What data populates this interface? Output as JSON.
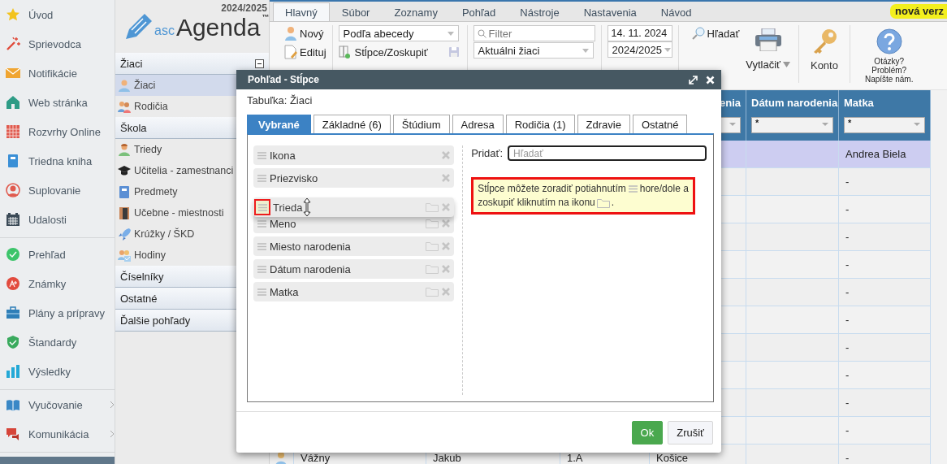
{
  "nav": {
    "groups": [
      [
        {
          "label": "Úvod",
          "expandable": false
        },
        {
          "label": "Sprievodca",
          "expandable": false
        },
        {
          "label": "Notifikácie",
          "expandable": false
        },
        {
          "label": "Web stránka",
          "expandable": false
        },
        {
          "label": "Rozvrhy Online",
          "expandable": false
        },
        {
          "label": "Triedna kniha",
          "expandable": false
        },
        {
          "label": "Suplovanie",
          "expandable": false
        },
        {
          "label": "Udalosti",
          "expandable": false
        }
      ],
      [
        {
          "label": "Prehľad",
          "expandable": false
        },
        {
          "label": "Známky",
          "expandable": false
        },
        {
          "label": "Plány a prípravy",
          "expandable": false
        },
        {
          "label": "Štandardy",
          "expandable": false
        },
        {
          "label": "Výsledky",
          "expandable": false
        }
      ],
      [
        {
          "label": "Vyučovanie",
          "expandable": true
        },
        {
          "label": "Komunikácia",
          "expandable": true
        }
      ]
    ]
  },
  "logo": {
    "year": "2024/2025",
    "prefix": "asc",
    "brand": "Agenda",
    "trademark": "™"
  },
  "sections": [
    {
      "label": "Žiaci",
      "collapsible": true,
      "items": [
        {
          "label": "Žiaci",
          "selected": true
        },
        {
          "label": "Rodičia",
          "selected": false
        }
      ]
    },
    {
      "label": "Škola",
      "items": [
        {
          "label": "Triedy",
          "selected": false
        },
        {
          "label": "Učitelia - zamestnanci",
          "selected": false
        },
        {
          "label": "Predmety",
          "selected": false
        },
        {
          "label": "Učebne - miestnosti",
          "selected": false
        },
        {
          "label": "Krúžky / ŠKD",
          "selected": false
        },
        {
          "label": "Hodiny",
          "selected": false
        }
      ]
    },
    {
      "label": "Číselníky"
    },
    {
      "label": "Ostatné"
    },
    {
      "label": "Ďalšie pohľady"
    }
  ],
  "menu_tabs": [
    {
      "label": "Hlavný",
      "selected": true
    },
    {
      "label": "Súbor",
      "selected": false
    },
    {
      "label": "Zoznamy",
      "selected": false
    },
    {
      "label": "Pohľad",
      "selected": false
    },
    {
      "label": "Nástroje",
      "selected": false
    },
    {
      "label": "Nastavenia",
      "selected": false
    },
    {
      "label": "Návod",
      "selected": false
    }
  ],
  "badge": "nová verz",
  "ribbon": {
    "new": "Nový",
    "edit": "Edituj",
    "sort": "Podľa abecedy",
    "columns": "Stĺpce/Zoskupiť",
    "filter_placeholder": "Filter",
    "scope": "Aktuálni žiaci",
    "date": "14. 11. 2024",
    "year": "2024/2025",
    "search": "Hľadať",
    "print": "Vytlačiť",
    "account": "Konto",
    "help": [
      "Otázky?",
      "Problém?",
      "Napíšte nám."
    ]
  },
  "table": {
    "columns": [
      {
        "label": "enia"
      },
      {
        "label": "Dátum narodenia",
        "filter": "*"
      },
      {
        "label": "Matka",
        "filter": "*"
      }
    ],
    "rows": [
      {
        "selected": true,
        "cells": {
          "mother": "Andrea Biela"
        }
      },
      {
        "selected": false,
        "cells": {
          "mother": "-"
        }
      },
      {
        "selected": false,
        "cells": {
          "mother": "-"
        }
      },
      {
        "selected": false,
        "cells": {
          "mother": "-"
        }
      },
      {
        "selected": false,
        "cells": {
          "mother": "-"
        }
      },
      {
        "selected": false,
        "cells": {
          "mother": "-"
        }
      },
      {
        "selected": false,
        "cells": {
          "mother": "-"
        }
      },
      {
        "selected": false,
        "cells": {
          "mother": "-"
        }
      },
      {
        "selected": false,
        "cells": {
          "mother": "-"
        }
      },
      {
        "selected": false,
        "cells": {
          "mother": "-"
        }
      },
      {
        "selected": false,
        "cells": {
          "mother": "-"
        }
      },
      {
        "selected": false,
        "cells": {
          "surname": "Vážny",
          "first_name": "Jakub",
          "class": "1.A",
          "birthplace": "Košice",
          "mother": "-"
        }
      }
    ]
  },
  "dialog": {
    "title": "Pohľad - Stĺpce",
    "table_label": "Tabuľka: Žiaci",
    "tabs": [
      {
        "label": "Vybrané",
        "selected": true
      },
      {
        "label": "Základné (6)",
        "selected": false
      },
      {
        "label": "Štúdium",
        "selected": false
      },
      {
        "label": "Adresa",
        "selected": false
      },
      {
        "label": "Rodičia (1)",
        "selected": false
      },
      {
        "label": "Zdravie",
        "selected": false
      },
      {
        "label": "Ostatné",
        "selected": false
      }
    ],
    "columns": [
      {
        "label": "Ikona",
        "groupable": false,
        "dragging": false,
        "handle_highlighted": false
      },
      {
        "label": "Priezvisko",
        "groupable": false,
        "dragging": false,
        "handle_highlighted": false
      },
      {
        "label": "Trieda",
        "groupable": true,
        "dragging": true,
        "handle_highlighted": true
      },
      {
        "label": "Meno",
        "groupable": true,
        "dragging": false,
        "handle_highlighted": false
      },
      {
        "label": "Miesto narodenia",
        "groupable": true,
        "dragging": false,
        "handle_highlighted": false
      },
      {
        "label": "Dátum narodenia",
        "groupable": true,
        "dragging": false,
        "handle_highlighted": false
      },
      {
        "label": "Matka",
        "groupable": true,
        "dragging": false,
        "handle_highlighted": false
      }
    ],
    "add_label": "Pridať:",
    "search_placeholder": "Hľadať",
    "hint": {
      "highlighted": true,
      "parts": [
        "Stĺpce môžete zoradiť potiahnutím",
        "hore/dole a",
        "zoskupiť kliknutím na ikonu",
        "."
      ]
    },
    "buttons": [
      {
        "label": "Ok",
        "kind": "primary"
      },
      {
        "label": "Zrušiť",
        "kind": "secondary"
      }
    ]
  }
}
